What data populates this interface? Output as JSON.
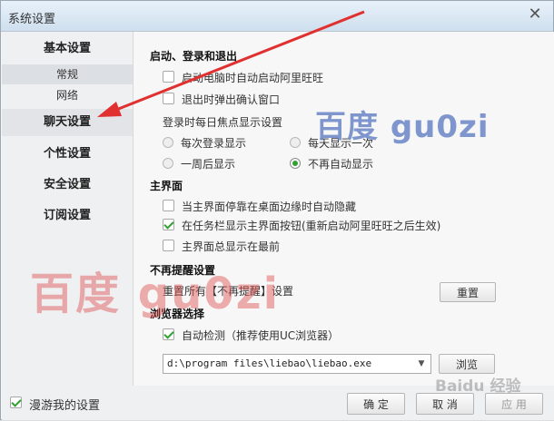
{
  "window": {
    "title": "系统设置",
    "close_glyph": "✕"
  },
  "sidebar": {
    "basic": "基本设置",
    "sub_general": "常规",
    "sub_network": "网络",
    "chat": "聊天设置",
    "personal": "个性设置",
    "security": "安全设置",
    "subscribe": "订阅设置"
  },
  "startup": {
    "title": "启动、登录和退出",
    "auto_start": "启动电脑时自动启动阿里旺旺",
    "confirm_exit": "退出时弹出确认窗口",
    "focus_label": "登录时每日焦点显示设置",
    "radio_each_login": "每次登录显示",
    "radio_once_day": "每天显示一次",
    "radio_week": "一周后显示",
    "radio_never": "不再自动显示",
    "selected": "不再自动显示"
  },
  "main_panel": {
    "title": "主界面",
    "auto_hide": "当主界面停靠在桌面边缘时自动隐藏",
    "taskbar": "在任务栏显示主界面按钮(重新启动阿里旺旺之后生效)",
    "always_top": "主界面总显示在最前",
    "checked": {
      "auto_hide": false,
      "taskbar": true,
      "always_top": false
    }
  },
  "reminder": {
    "title": "不再提醒设置",
    "reset_text": "重置所有【不再提醒】设置",
    "reset_button": "重置"
  },
  "browser": {
    "title": "浏览器选择",
    "auto_detect": "自动检测（推荐使用UC浏览器）",
    "auto_detect_checked": true,
    "path": "d:\\program files\\liebao\\liebao.exe",
    "browse_button": "浏览"
  },
  "footer": {
    "roam_label": "漫游我的设置",
    "roam_checked": true,
    "ok_button": "确 定",
    "cancel_button": "取 消",
    "apply_button": "应 用"
  },
  "watermarks": {
    "blue": "百度 gu0zi",
    "red": "百度 gu0zi",
    "corner": "Baidu 经验"
  },
  "colors": {
    "accent_green": "#2fa12f",
    "arrow_red": "#e03030"
  }
}
